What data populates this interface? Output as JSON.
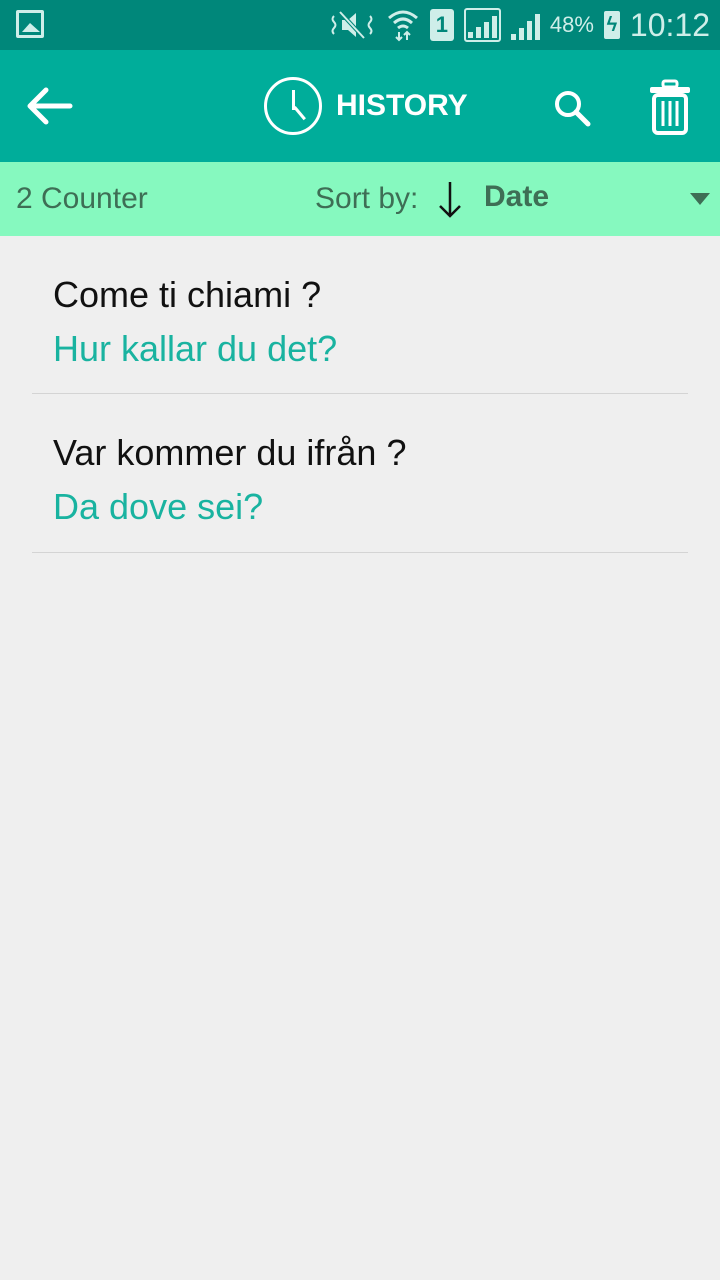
{
  "status_bar": {
    "battery_percent": "48%",
    "time": "10:12",
    "sim_label": "1",
    "icons": [
      "image-icon",
      "mute-icon",
      "wifi-icon",
      "sim-icon",
      "signal-icon",
      "signal-icon",
      "battery-charging-icon"
    ]
  },
  "app_bar": {
    "title": "HISTORY",
    "back_icon": "arrow-left-icon",
    "title_icon": "clock-icon",
    "search_icon": "search-icon",
    "delete_icon": "trash-icon"
  },
  "sort_bar": {
    "counter": "2 Counter",
    "sort_label": "Sort by:",
    "sort_direction_icon": "arrow-down-icon",
    "sort_value": "Date"
  },
  "colors": {
    "status_bar": "#00877a",
    "app_bar": "#00ad9a",
    "sort_bar": "#86f9bf",
    "translation_text": "#19b3a0"
  },
  "history": [
    {
      "source": "Come ti chiami ?",
      "translation": "Hur kallar du det?"
    },
    {
      "source": "Var kommer du ifrån ?",
      "translation": "Da dove sei?"
    }
  ]
}
